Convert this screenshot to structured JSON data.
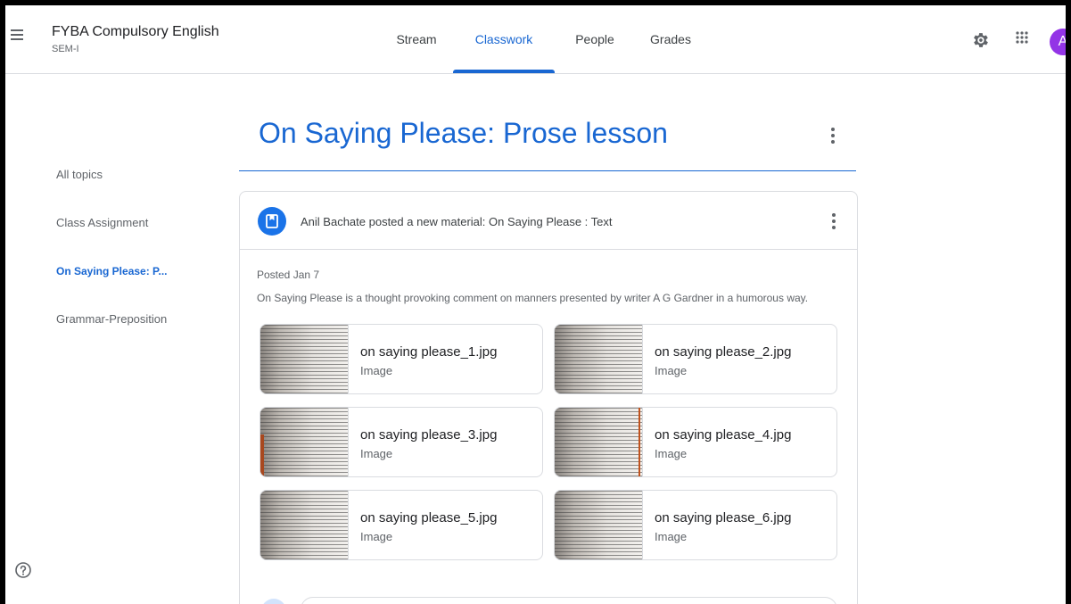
{
  "header": {
    "class_title": "FYBA Compulsory English",
    "class_section": "SEM-I",
    "tabs": [
      {
        "label": "Stream",
        "active": false
      },
      {
        "label": "Classwork",
        "active": true
      },
      {
        "label": "People",
        "active": false
      },
      {
        "label": "Grades",
        "active": false
      }
    ],
    "avatar_initial": "A",
    "icons": [
      "menu-icon",
      "gear-icon",
      "apps-grid-icon"
    ]
  },
  "sidebar": {
    "items": [
      {
        "label": "All topics",
        "active": false
      },
      {
        "label": "Class Assignment",
        "active": false
      },
      {
        "label": "On Saying Please: P...",
        "active": true
      },
      {
        "label": "Grammar-Preposition",
        "active": false
      }
    ]
  },
  "topic": {
    "title": "On Saying Please: Prose lesson"
  },
  "material": {
    "heading": "Anil Bachate posted a new material: On Saying Please : Text",
    "posted": "Posted Jan 7",
    "description": "On Saying Please is a thought provoking comment on manners presented by writer A G Gardner in a humorous way.",
    "attachments": [
      {
        "name": "on saying please_1.jpg",
        "type": "Image"
      },
      {
        "name": "on saying please_2.jpg",
        "type": "Image"
      },
      {
        "name": "on saying please_3.jpg",
        "type": "Image"
      },
      {
        "name": "on saying please_4.jpg",
        "type": "Image"
      },
      {
        "name": "on saying please_5.jpg",
        "type": "Image"
      },
      {
        "name": "on saying please_6.jpg",
        "type": "Image"
      }
    ]
  },
  "colors": {
    "accent": "#1967d2",
    "avatar": "#9334e6",
    "material_icon": "#1a73e8"
  }
}
